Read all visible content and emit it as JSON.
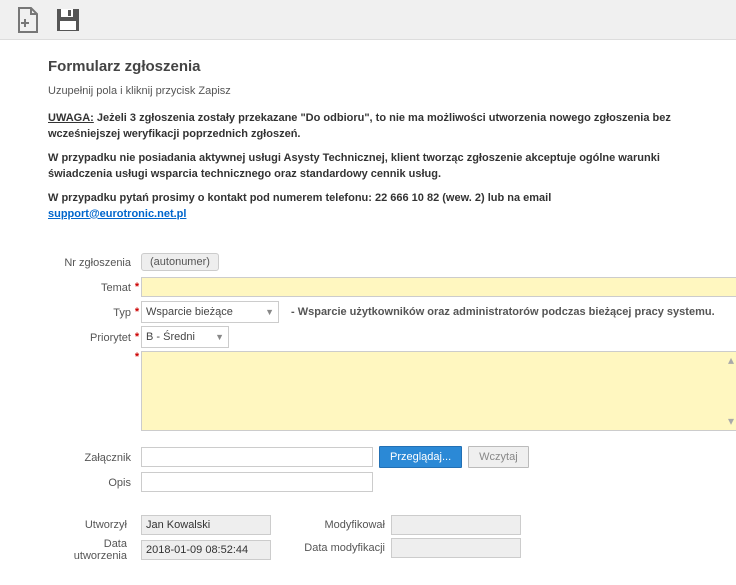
{
  "toolbar": {
    "icon_new": "new-file-plus-icon",
    "icon_save": "save-floppy-icon"
  },
  "header": {
    "title": "Formularz zgłoszenia",
    "subtitle": "Uzupełnij pola i kliknij przycisk Zapisz",
    "uwaga_label": "UWAGA:",
    "uwaga_text": " Jeżeli 3 zgłoszenia zostały przekazane \"Do odbioru\", to nie ma możliwości utworzenia nowego zgłoszenia bez wcześniejszej weryfikacji poprzednich zgłoszeń.",
    "notice2": "W przypadku nie posiadania aktywnej usługi Asysty Technicznej, klient tworząc zgłoszenie akceptuje ogólne warunki świadczenia usługi wsparcia technicznego oraz standardowy cennik usług.",
    "contact_text": "W przypadku pytań prosimy o kontakt pod numerem telefonu: 22 666 10 82 (wew. 2) lub na email",
    "email": "support@eurotronic.net.pl"
  },
  "labels": {
    "nr": "Nr zgłoszenia",
    "temat": "Temat",
    "typ": "Typ",
    "priorytet": "Priorytet",
    "zalacznik": "Załącznik",
    "opis": "Opis",
    "utworzyl": "Utworzył",
    "data_utworzenia": "Data utworzenia",
    "modyfikowal": "Modyfikował",
    "data_modyfikacji": "Data modyfikacji"
  },
  "values": {
    "nr_auto": "(autonumer)",
    "typ_selected": "Wsparcie bieżące",
    "typ_hint": "- Wsparcie użytkowników oraz administratorów podczas bieżącej pracy systemu.",
    "priorytet_selected": "B - Średni",
    "przegladaj_btn": "Przeglądaj...",
    "wczytaj_btn": "Wczytaj",
    "utworzyl": "Jan Kowalski",
    "data_utworzenia": "2018-01-09 08:52:44",
    "modyfikowal": "",
    "data_modyfikacji": ""
  }
}
